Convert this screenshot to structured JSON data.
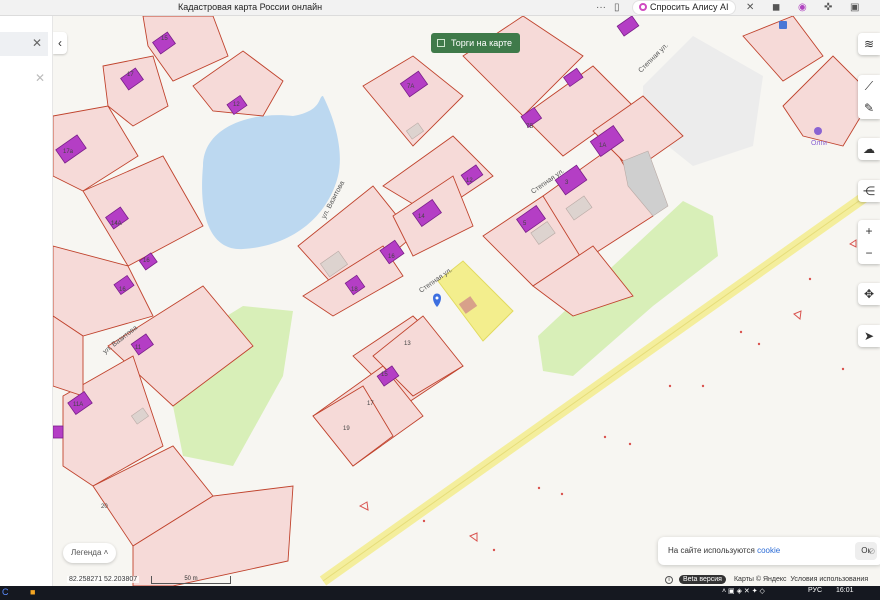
{
  "browser": {
    "title": "Кадастровая карта России онлайн",
    "ellipsis": "···",
    "alice_label": "Спросить Алису AI"
  },
  "map": {
    "torgi_label": "Торги на карте",
    "streets": [
      "ул. Вазитова",
      "Степная ул.",
      "Степная ул.",
      "ул. Вазитова",
      "Степная ул."
    ],
    "parcel_numbers": [
      "15",
      "17",
      "17а",
      "7А",
      "12",
      "16",
      "14",
      "18",
      "16",
      "5",
      "3",
      "1А",
      "14",
      "20",
      "17",
      "19",
      "13",
      "15",
      "11",
      "11А",
      "14А",
      "16",
      "12",
      "7Б",
      "20"
    ],
    "poi_label": "Олги",
    "colors": {
      "parcel_fill": "#f6dad8",
      "parcel_border": "#c0432d",
      "building": "#b43ec5",
      "water": "#bcd8f0",
      "green": "#d8efb8",
      "highlight": "#f3ee83",
      "road": "#f4ee9c"
    }
  },
  "controls": {
    "legend_label": "Легенда",
    "cookie_text": "На сайте используются ",
    "cookie_link": "cookie",
    "cookie_ok": "Ок",
    "coords": "82.258271  52.203807",
    "scale_label": "50 m",
    "beta_label": "Beta версия",
    "copyright": "Карты © Яндекс",
    "terms": "Условия использования"
  },
  "taskbar": {
    "lang": "РУС",
    "time": "16:01"
  }
}
